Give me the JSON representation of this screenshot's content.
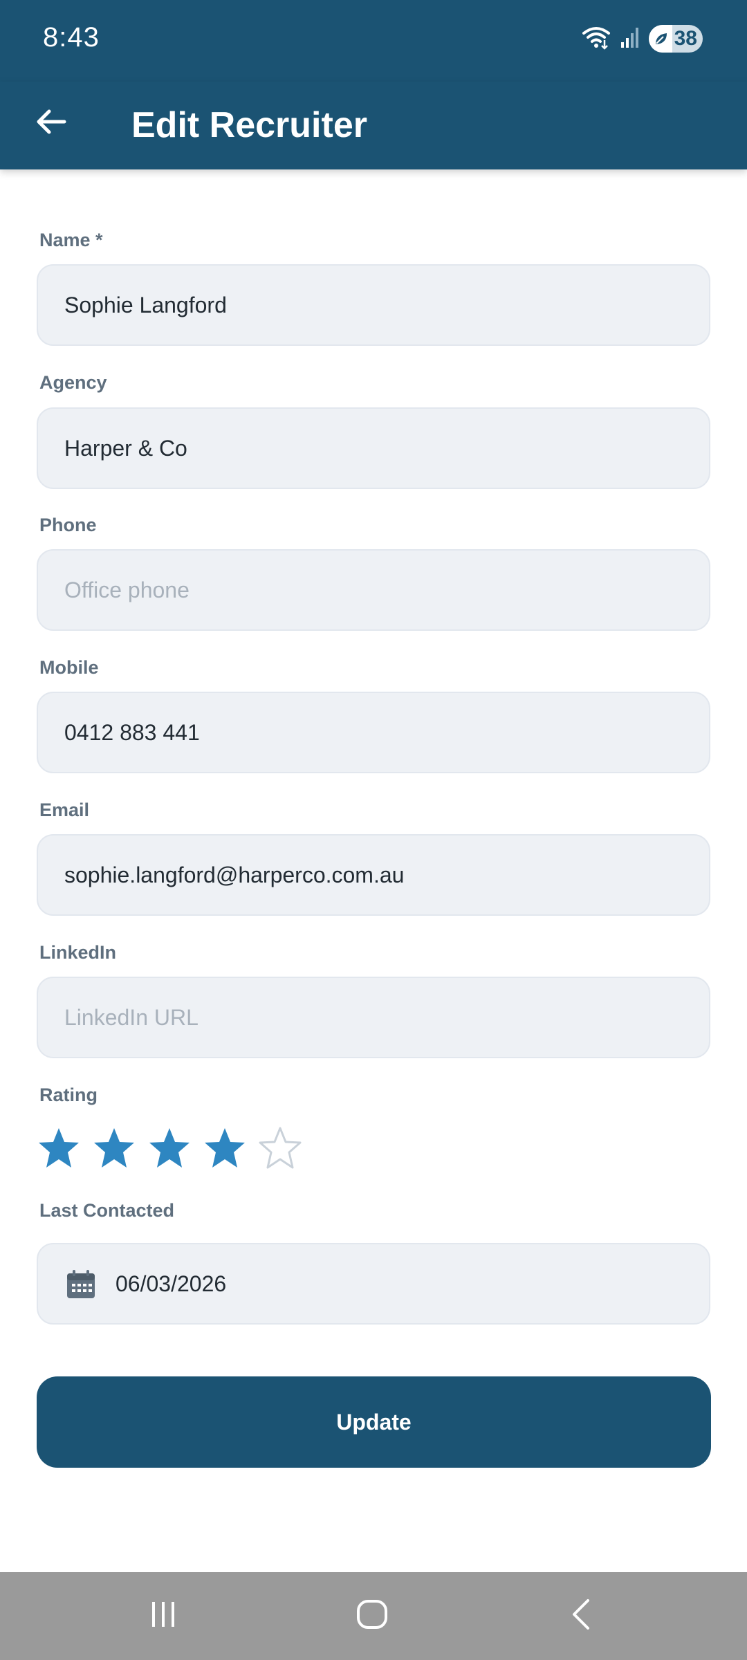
{
  "status_bar": {
    "time": "8:43",
    "battery_level": "38",
    "icons": [
      "wifi-icon",
      "signal-icon",
      "battery-saver-icon"
    ]
  },
  "app_bar": {
    "title": "Edit Recruiter",
    "back_icon": "arrow-left-icon",
    "background_color": "#1b5373"
  },
  "form": {
    "name": {
      "label": "Name *",
      "value": "Sophie Langford",
      "placeholder": ""
    },
    "agency": {
      "label": "Agency",
      "value": "Harper & Co",
      "placeholder": ""
    },
    "phone": {
      "label": "Phone",
      "value": "",
      "placeholder": "Office phone"
    },
    "mobile": {
      "label": "Mobile",
      "value": "0412 883 441",
      "placeholder": ""
    },
    "email": {
      "label": "Email",
      "value": "sophie.langford@harperco.com.au",
      "placeholder": ""
    },
    "linkedin": {
      "label": "LinkedIn",
      "value": "",
      "placeholder": "LinkedIn URL"
    },
    "rating": {
      "label": "Rating",
      "value": 4,
      "max": 5,
      "star_color": "#2e86c1",
      "empty_star_color": "#c9d1d9"
    },
    "last_contacted": {
      "label": "Last Contacted",
      "value": "06/03/2026",
      "icon": "calendar-icon"
    }
  },
  "actions": {
    "update_label": "Update"
  },
  "nav_bar": {
    "items": [
      "recent-apps-icon",
      "home-icon",
      "back-icon"
    ]
  }
}
